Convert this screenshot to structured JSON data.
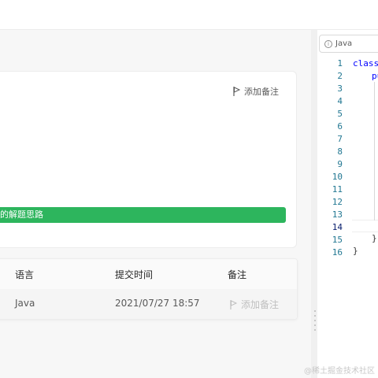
{
  "problem_panel": {
    "add_note_label": "添加备注",
    "solution_bar_text": "的解题思路"
  },
  "submissions_table": {
    "columns": [
      "语言",
      "提交时间",
      "备注"
    ],
    "rows": [
      {
        "language": "Java",
        "submitted_at": "2021/07/27 18:57",
        "note_action": "添加备注"
      }
    ]
  },
  "editor": {
    "language": "Java",
    "line_numbers": [
      "1",
      "2",
      "3",
      "4",
      "5",
      "6",
      "7",
      "8",
      "9",
      "10",
      "11",
      "12",
      "13",
      "14",
      "15",
      "16"
    ],
    "active_line": "14",
    "code": {
      "line1": "class",
      "line2": "pu",
      "line15": "}",
      "line16": "}"
    }
  },
  "watermark": "@稀土掘金技术社区",
  "colors": {
    "accent_green": "#2db55d",
    "line_number": "#237893",
    "keyword": "#0000ff"
  }
}
